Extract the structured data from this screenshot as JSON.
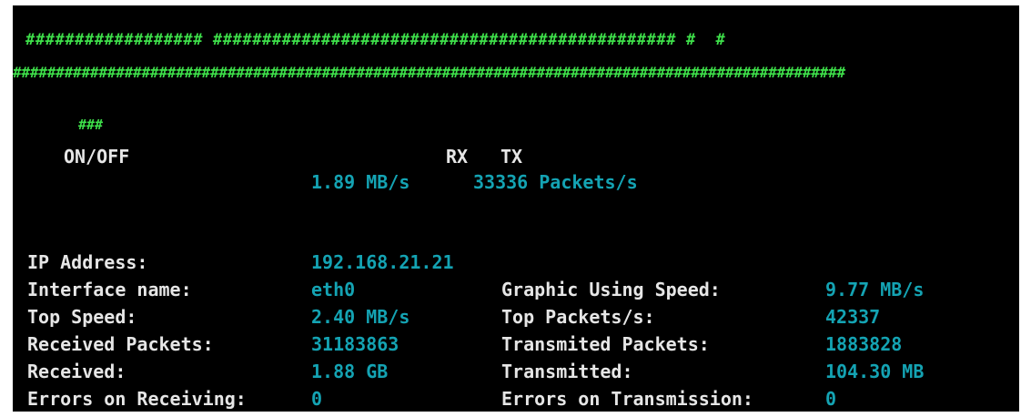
{
  "header": {
    "hash_bar_top": "################## ############################################### #  #",
    "hash_bar_full": "#################################################################################################"
  },
  "activity": {
    "indicator": "###",
    "on_off_label": "ON/OFF",
    "rx_label": "RX",
    "tx_label": "TX",
    "rx_value": "1.89 MB/s",
    "tx_value": "33336 Packets/s"
  },
  "stats_left": [
    {
      "label": "IP Address:",
      "value": "192.168.21.21"
    },
    {
      "label": "Interface name:",
      "value": "eth0"
    },
    {
      "label": "Top Speed:",
      "value": "2.40 MB/s"
    },
    {
      "label": "Received Packets:",
      "value": "31183863"
    },
    {
      "label": "Received:",
      "value": "1.88 GB"
    },
    {
      "label": "Errors on Receiving:",
      "value": "0"
    }
  ],
  "stats_right": [
    {
      "label": "Graphic Using Speed:",
      "value": "9.77 MB/s"
    },
    {
      "label": "Top Packets/s:",
      "value": "42337"
    },
    {
      "label": "Transmited Packets:",
      "value": "1883828"
    },
    {
      "label": "Transmitted:",
      "value": "104.30 MB"
    },
    {
      "label": "Errors on Transmission:",
      "value": "0"
    }
  ],
  "colors": {
    "background": "#000000",
    "hash_green": "#3ee04a",
    "label_white": "#e6e6e6",
    "value_cyan": "#14a3b3"
  }
}
